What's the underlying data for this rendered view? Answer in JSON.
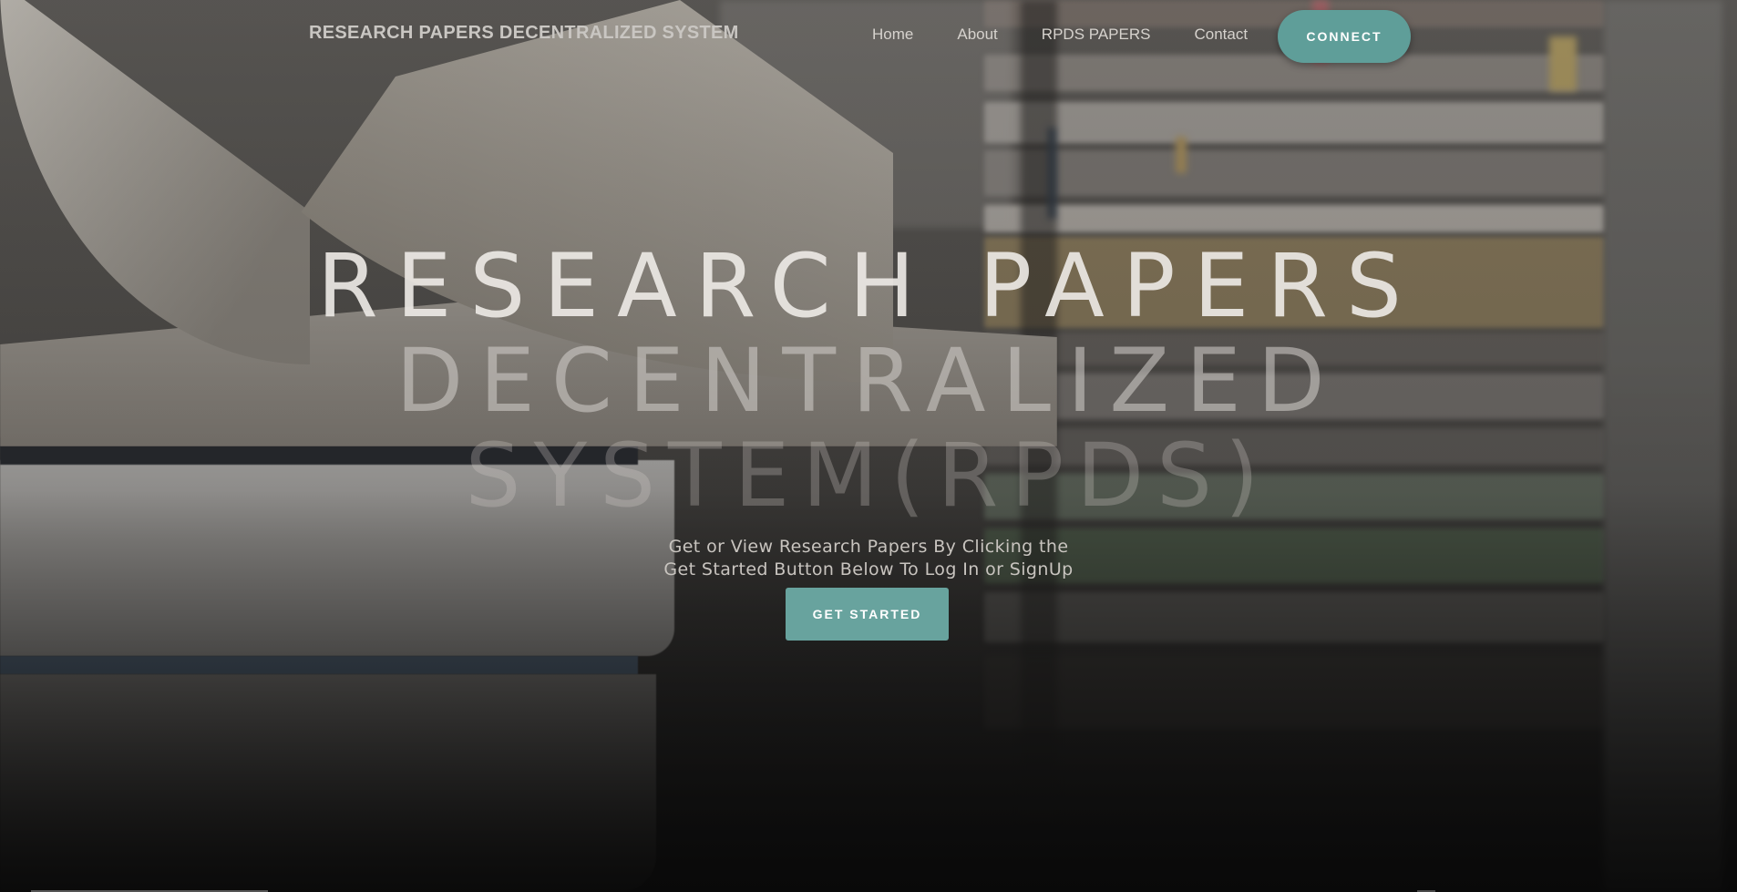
{
  "header": {
    "brand": "RESEARCH PAPERS DECENTRALIZED SYSTEM",
    "nav": [
      {
        "label": "Home"
      },
      {
        "label": "About"
      },
      {
        "label": "RPDS PAPERS"
      },
      {
        "label": "Contact"
      }
    ],
    "connect_label": "CONNECT"
  },
  "hero": {
    "title_lines": [
      "RESEARCH PAPERS",
      "DECENTRALIZED",
      "SYSTEM(RPDS)"
    ],
    "subtitle_lines": [
      "Get or View Research Papers By Clicking the",
      "Get Started Button Below To Log In or SignUp"
    ],
    "cta_label": "GET STARTED"
  },
  "theme": {
    "accent": "#5f9e99",
    "button": "#68a39e",
    "background_image": "open-books-on-shelf"
  }
}
